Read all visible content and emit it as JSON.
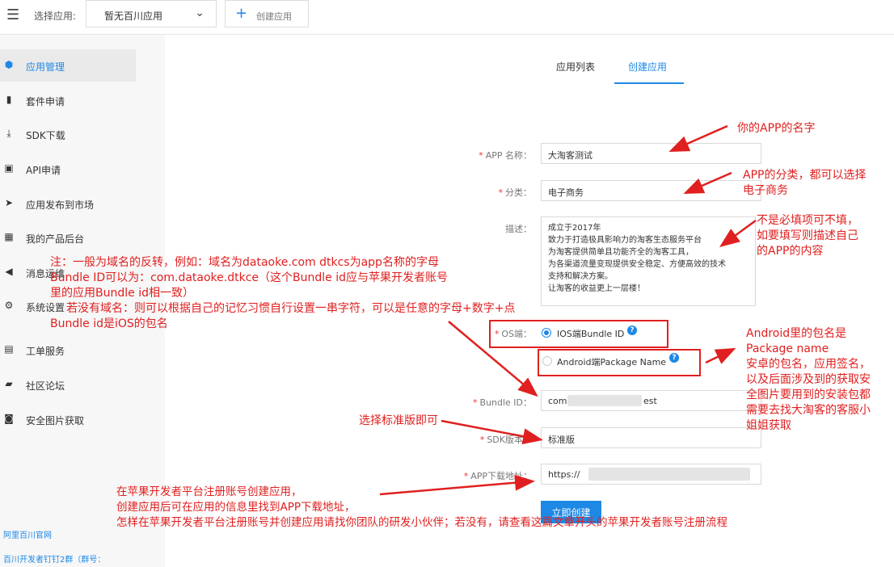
{
  "topbar": {
    "select_label": "选择应用:",
    "selected_app": "暂无百川应用",
    "create_label": "创建应用"
  },
  "sidebar": {
    "items": [
      {
        "label": "应用管理",
        "icon": "cube-icon"
      },
      {
        "label": "套件申请",
        "icon": "book-icon"
      },
      {
        "label": "SDK下载",
        "icon": "download-icon"
      },
      {
        "label": "API申请",
        "icon": "terminal-icon"
      },
      {
        "label": "应用发布到市场",
        "icon": "send-icon"
      },
      {
        "label": "我的产品后台",
        "icon": "grid-icon"
      },
      {
        "label": "消息运维",
        "icon": "megaphone-icon"
      },
      {
        "label": "系统设置",
        "icon": "gear-icon"
      },
      {
        "label": "工单服务",
        "icon": "ticket-icon"
      },
      {
        "label": "社区论坛",
        "icon": "chat-icon"
      },
      {
        "label": "安全图片获取",
        "icon": "image-icon"
      }
    ],
    "footer_links": [
      "阿里百川官网",
      "百川开发者钉钉2群（群号："
    ]
  },
  "tabs": [
    "应用列表",
    "创建应用"
  ],
  "form": {
    "app_name_label": "APP 名称：",
    "app_name_value": "大淘客测试",
    "category_label": "分类：",
    "category_value": "电子商务",
    "desc_label": "描述：",
    "desc_lines": [
      "成立于2017年",
      "致力于打造极具影响力的淘客生态服务平台",
      "为淘客提供简单且功能齐全的淘客工具，",
      "为各渠道流量变现提供安全稳定、方便高效的技术",
      "支持和解决方案。",
      "让淘客的收益更上一层楼！"
    ],
    "os_label": "OS端：",
    "os_ios": "IOS端Bundle ID",
    "os_android": "Android端Package Name",
    "bundle_label": "Bundle ID：",
    "bundle_prefix": "com.",
    "bundle_suffix": "est",
    "sdk_label": "SDK版本：",
    "sdk_value": "标准版",
    "download_label": "APP下载地址：",
    "download_prefix": "https://",
    "submit_label": "立即创建"
  },
  "annotations": {
    "name_note": "你的APP的名字",
    "category_note": [
      "APP的分类，都可以选择",
      "电子商务"
    ],
    "desc_note": [
      "不是必填项可不填，",
      "如要填写则描述自己",
      "的APP的内容"
    ],
    "bundle_note": [
      "注：一般为域名的反转，例如：域名为dataoke.com  dtkcs为app名称的字母",
      "Bundle ID可以为：com.dataoke.dtkce（这个Bundle id应与苹果开发者账号",
      "里的应用Bundle id相一致）",
      "若没有域名：则可以根据自己的记忆习惯自行设置一串字符，可以是任意的字母+数字+点",
      "Bundle id是iOS的包名"
    ],
    "android_note": [
      "Android里的包名是",
      "Package name",
      "安卓的包名，应用签名，",
      "以及后面涉及到的获取安",
      "全图片要用到的安装包都",
      "需要去找大淘客的客服小",
      "姐姐获取"
    ],
    "sdk_note": "选择标准版即可",
    "download_note": [
      "在苹果开发者平台注册账号创建应用，",
      "创建应用后可在应用的信息里找到APP下载地址，",
      "怎样在苹果开发者平台注册账号并创建应用请找你团队的研发小伙伴；若没有，请查看这篇文章开头的苹果开发者账号注册流程"
    ]
  },
  "colors": {
    "accent": "#1e88e5",
    "annotation": "#e02020"
  }
}
